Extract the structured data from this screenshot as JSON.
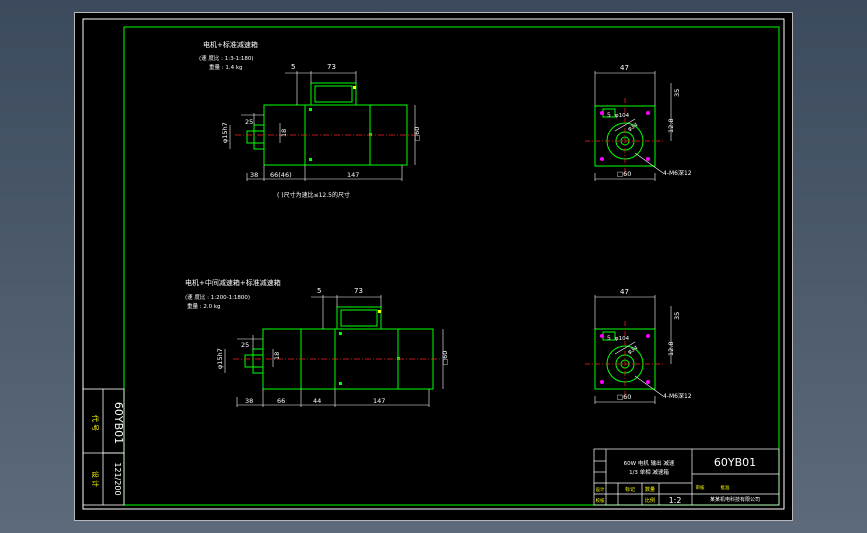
{
  "drawing": {
    "part_code": "60YB01",
    "scale": "1:1",
    "sheet_code_side": "60YB01",
    "vertical_small": "121/200",
    "side_label_top": "代 号",
    "side_label_bottom": "设 计"
  },
  "view_top": {
    "title": "电机+标准减速箱",
    "ratio_note": "(速 度比 : 1:3-1:180)",
    "weight_note": "重量 : 1.4 kg",
    "dim_shaft_dia": "φ15h7",
    "dim_key_len": "25",
    "dim_key_h": "18",
    "dim_5": "5",
    "dim_73": "73",
    "dim_38": "38",
    "dim_66": "66(46)",
    "dim_147": "147",
    "dim_square": "□60",
    "footnote": "( )尺寸为速比≤12.5的尺寸"
  },
  "view_bottom": {
    "title": "电机+中间减速箱+标准减速箱",
    "ratio_note": "(速 度比 : 1:200-1:1800)",
    "weight_note": "重量 : 2.0 kg",
    "dim_shaft_dia": "φ15h7",
    "dim_key_len": "25",
    "dim_key_h": "18",
    "dim_5": "5",
    "dim_73": "73",
    "dim_38": "38",
    "dim_66": "66",
    "dim_44": "44",
    "dim_147": "147",
    "dim_square": "□60"
  },
  "side_view_top": {
    "dim_47": "47",
    "dim_35": "35",
    "dim_128": "12.8",
    "dim_sq60": "□60",
    "dim_dia104": "φ104",
    "dim_dia34": "φ34",
    "dim_5": "5",
    "holes": "4-M6深12"
  },
  "side_view_bottom": {
    "dim_47": "47",
    "dim_35": "35",
    "dim_128": "12.8",
    "dim_sq60": "□60",
    "dim_dia104": "φ104",
    "dim_dia34": "φ34",
    "dim_5": "5",
    "holes": "4-M6深12"
  },
  "title_block": {
    "drawing_no": "60YB01",
    "name_line1": "60W 电机 输出 减速",
    "name_line2": "1/3 单相 减速箱",
    "scale_val": "1:2",
    "company": "某某机电科技有限公司",
    "row_label_1": "设计",
    "row_label_2": "校核",
    "row_label_3": "审核",
    "row_label_4": "批准",
    "col_label_1": "标记",
    "col_label_2": "数量",
    "col_label_3": "比例"
  },
  "colors": {
    "frame": "#00ff00",
    "outline": "#00ff00",
    "dimension": "#ffffff",
    "centerline": "#ff2020",
    "accent": "#ffff00",
    "highlight": "#ff00ff"
  }
}
